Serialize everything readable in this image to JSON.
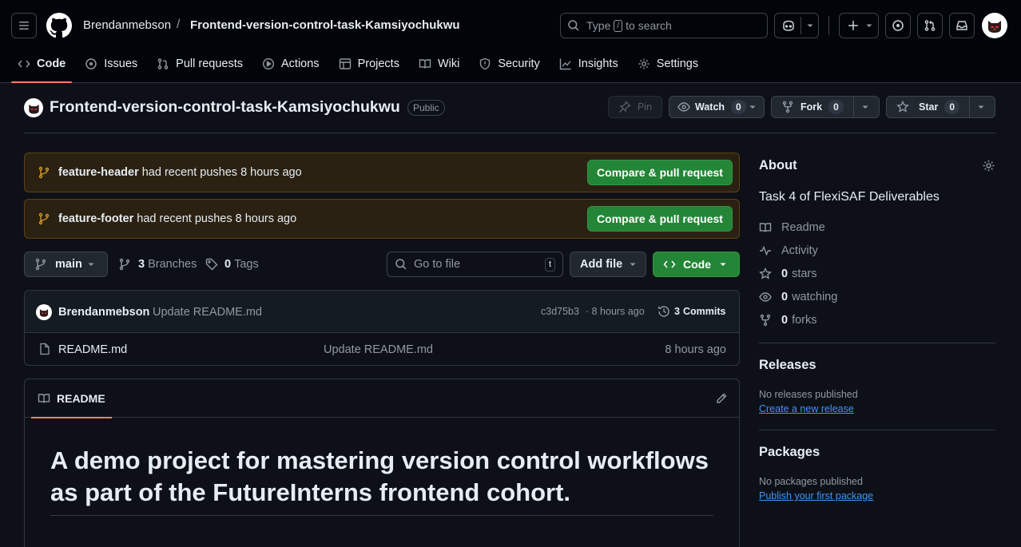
{
  "header": {
    "owner": "Brendanmebson",
    "separator": "/",
    "repo": "Frontend-version-control-task-Kamsiyochukwu",
    "search": {
      "prefix": "Type",
      "key": "/",
      "suffix": "to search"
    }
  },
  "nav": {
    "tabs": [
      {
        "label": "Code",
        "icon": "code-icon"
      },
      {
        "label": "Issues",
        "icon": "issue-icon"
      },
      {
        "label": "Pull requests",
        "icon": "pull-request-icon"
      },
      {
        "label": "Actions",
        "icon": "play-icon"
      },
      {
        "label": "Projects",
        "icon": "table-icon"
      },
      {
        "label": "Wiki",
        "icon": "book-icon"
      },
      {
        "label": "Security",
        "icon": "shield-icon"
      },
      {
        "label": "Insights",
        "icon": "graph-icon"
      },
      {
        "label": "Settings",
        "icon": "gear-icon"
      }
    ]
  },
  "repo_header": {
    "title": "Frontend-version-control-task-Kamsiyochukwu",
    "visibility": "Public",
    "pin_label": "Pin",
    "watch_label": "Watch",
    "watch_count": "0",
    "fork_label": "Fork",
    "fork_count": "0",
    "star_label": "Star",
    "star_count": "0"
  },
  "banners": [
    {
      "branch": "feature-header",
      "text": "had recent pushes 8 hours ago",
      "button": "Compare & pull request"
    },
    {
      "branch": "feature-footer",
      "text": "had recent pushes 8 hours ago",
      "button": "Compare & pull request"
    }
  ],
  "toolbar": {
    "branch": "main",
    "branches_count": "3",
    "branches_label": "Branches",
    "tags_count": "0",
    "tags_label": "Tags",
    "goto_placeholder": "Go to file",
    "goto_key": "t",
    "add_file": "Add file",
    "code_button": "Code"
  },
  "latest_commit": {
    "author": "Brendanmebson",
    "message": "Update README.md",
    "hash": "c3d75b3",
    "time": "· 8 hours ago",
    "commits_count": "3",
    "commits_label": "Commits"
  },
  "files": [
    {
      "name": "README.md",
      "message": "Update README.md",
      "time": "8 hours ago"
    }
  ],
  "readme": {
    "tab_label": "README",
    "heading": "A demo project for mastering version control workflows as part of the FutureInterns frontend cohort."
  },
  "about": {
    "heading": "About",
    "description": "Task 4 of FlexiSAF Deliverables",
    "items": [
      {
        "icon": "book-icon",
        "count": "",
        "label": "Readme"
      },
      {
        "icon": "pulse-icon",
        "count": "",
        "label": "Activity"
      },
      {
        "icon": "star-icon",
        "count": "0",
        "label": "stars"
      },
      {
        "icon": "eye-icon",
        "count": "0",
        "label": "watching"
      },
      {
        "icon": "fork-icon",
        "count": "0",
        "label": "forks"
      }
    ]
  },
  "releases": {
    "heading": "Releases",
    "empty": "No releases published",
    "link": "Create a new release"
  },
  "packages": {
    "heading": "Packages",
    "empty": "No packages published",
    "link": "Publish your first package"
  },
  "colors": {
    "background": "#0d1117",
    "header_bg": "#010409",
    "accent_green": "#238636",
    "link_blue": "#4493f8",
    "banner_bg": "#2b2112",
    "tab_underline": "#f78166"
  }
}
